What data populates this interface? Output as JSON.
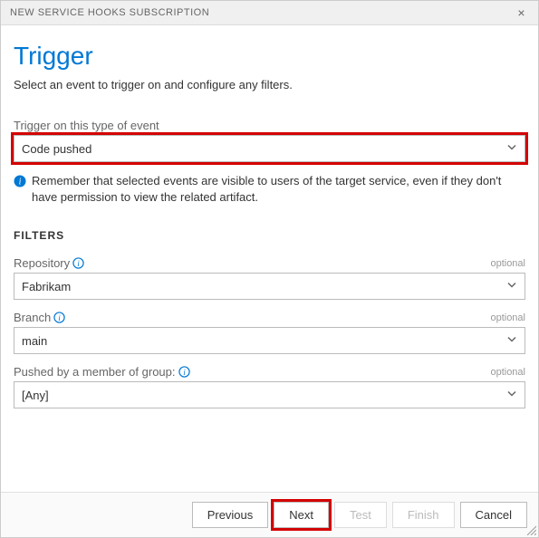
{
  "titlebar": {
    "title": "NEW SERVICE HOOKS SUBSCRIPTION"
  },
  "header": {
    "title": "Trigger",
    "subtitle": "Select an event to trigger on and configure any filters."
  },
  "eventField": {
    "label": "Trigger on this type of event",
    "value": "Code pushed"
  },
  "infoNote": "Remember that selected events are visible to users of the target service, even if they don't have permission to view the related artifact.",
  "filters": {
    "heading": "FILTERS",
    "repository": {
      "label": "Repository",
      "optional": "optional",
      "value": "Fabrikam"
    },
    "branch": {
      "label": "Branch",
      "optional": "optional",
      "value": "main"
    },
    "group": {
      "label": "Pushed by a member of group:",
      "optional": "optional",
      "value": "[Any]"
    }
  },
  "buttons": {
    "previous": "Previous",
    "next": "Next",
    "test": "Test",
    "finish": "Finish",
    "cancel": "Cancel"
  }
}
